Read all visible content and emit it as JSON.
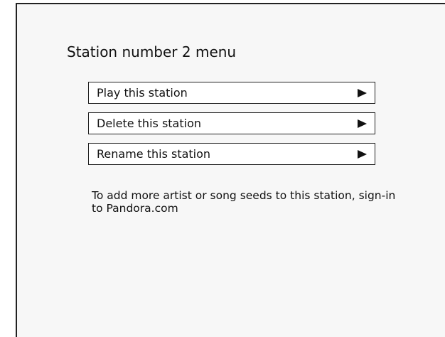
{
  "menu_title": "Station number 2 menu",
  "menu_items": [
    {
      "label": "Play this station",
      "icon": "play-arrow-icon"
    },
    {
      "label": "Delete this station",
      "icon": "play-arrow-icon"
    },
    {
      "label": "Rename this station",
      "icon": "play-arrow-icon"
    }
  ],
  "note": "To add more artist or song seeds to this station, sign-in to Pandora.com"
}
